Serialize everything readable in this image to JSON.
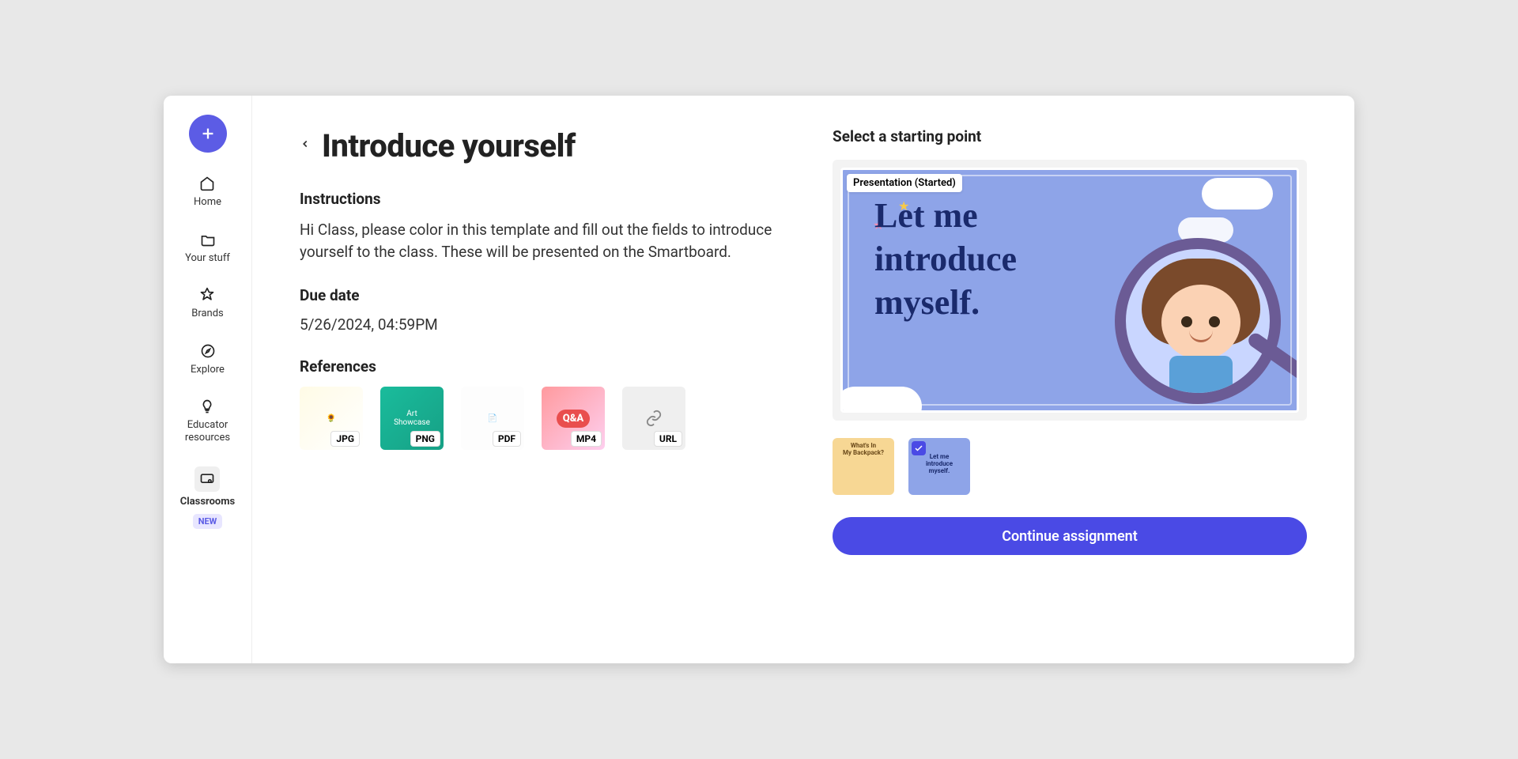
{
  "sidebar": {
    "items": [
      {
        "label": "Home"
      },
      {
        "label": "Your stuff"
      },
      {
        "label": "Brands"
      },
      {
        "label": "Explore"
      },
      {
        "label": "Educator\nresources"
      },
      {
        "label": "Classrooms"
      }
    ],
    "new_badge": "NEW"
  },
  "page": {
    "title": "Introduce yourself",
    "instructions_h": "Instructions",
    "instructions_body": "Hi Class, please color in this template and fill out the fields to introduce yourself to the class. These will be presented on the Smartboard.",
    "due_h": "Due date",
    "due_value": "5/26/2024, 04:59PM",
    "refs_h": "References",
    "refs": [
      {
        "tag": "JPG"
      },
      {
        "tag": "PNG"
      },
      {
        "tag": "PDF"
      },
      {
        "tag": "MP4"
      },
      {
        "tag": "URL"
      }
    ],
    "ref_inner": {
      "r2": "Art\nShowcase",
      "r4": "Q&A"
    }
  },
  "right": {
    "heading": "Select a starting point",
    "status": "Presentation (Started)",
    "slide_text": "Let me\nintroduce\nmyself.",
    "cta": "Continue assignment",
    "thumbs": [
      {
        "title": "What's In\nMy Backpack?"
      },
      {
        "title": "Let me\nintroduce\nmyself."
      }
    ]
  }
}
